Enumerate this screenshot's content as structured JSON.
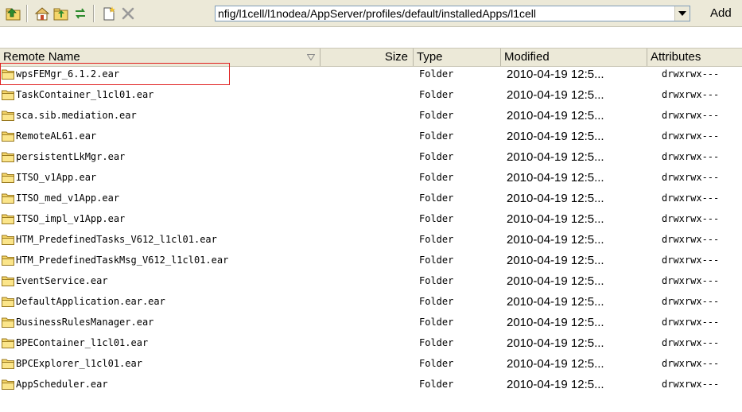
{
  "toolbar": {
    "icons": [
      "parent-directory-icon",
      "home-icon",
      "new-folder-icon",
      "refresh-icon",
      "new-file-icon",
      "delete-icon"
    ],
    "path_value": "nfig/l1cell/l1nodea/AppServer/profiles/default/installedApps/l1cell",
    "add_label": "Add"
  },
  "columns": {
    "name": "Remote Name",
    "size": "Size",
    "type": "Type",
    "modified": "Modified",
    "attributes": "Attributes"
  },
  "files": [
    {
      "name": "wpsFEMgr_6.1.2.ear",
      "type": "Folder",
      "modified": "2010-04-19 12:5...",
      "attributes": "drwxrwx---"
    },
    {
      "name": "TaskContainer_l1cl01.ear",
      "type": "Folder",
      "modified": "2010-04-19 12:5...",
      "attributes": "drwxrwx---"
    },
    {
      "name": "sca.sib.mediation.ear",
      "type": "Folder",
      "modified": "2010-04-19 12:5...",
      "attributes": "drwxrwx---"
    },
    {
      "name": "RemoteAL61.ear",
      "type": "Folder",
      "modified": "2010-04-19 12:5...",
      "attributes": "drwxrwx---"
    },
    {
      "name": "persistentLkMgr.ear",
      "type": "Folder",
      "modified": "2010-04-19 12:5...",
      "attributes": "drwxrwx---"
    },
    {
      "name": "ITSO_v1App.ear",
      "type": "Folder",
      "modified": "2010-04-19 12:5...",
      "attributes": "drwxrwx---"
    },
    {
      "name": "ITSO_med_v1App.ear",
      "type": "Folder",
      "modified": "2010-04-19 12:5...",
      "attributes": "drwxrwx---"
    },
    {
      "name": "ITSO_impl_v1App.ear",
      "type": "Folder",
      "modified": "2010-04-19 12:5...",
      "attributes": "drwxrwx---"
    },
    {
      "name": "HTM_PredefinedTasks_V612_l1cl01.ear",
      "type": "Folder",
      "modified": "2010-04-19 12:5...",
      "attributes": "drwxrwx---"
    },
    {
      "name": "HTM_PredefinedTaskMsg_V612_l1cl01.ear",
      "type": "Folder",
      "modified": "2010-04-19 12:5...",
      "attributes": "drwxrwx---"
    },
    {
      "name": "EventService.ear",
      "type": "Folder",
      "modified": "2010-04-19 12:5...",
      "attributes": "drwxrwx---"
    },
    {
      "name": "DefaultApplication.ear.ear",
      "type": "Folder",
      "modified": "2010-04-19 12:5...",
      "attributes": "drwxrwx---"
    },
    {
      "name": "BusinessRulesManager.ear",
      "type": "Folder",
      "modified": "2010-04-19 12:5...",
      "attributes": "drwxrwx---"
    },
    {
      "name": "BPEContainer_l1cl01.ear",
      "type": "Folder",
      "modified": "2010-04-19 12:5...",
      "attributes": "drwxrwx---"
    },
    {
      "name": "BPCExplorer_l1cl01.ear",
      "type": "Folder",
      "modified": "2010-04-19 12:5...",
      "attributes": "drwxrwx---"
    },
    {
      "name": "AppScheduler.ear",
      "type": "Folder",
      "modified": "2010-04-19 12:5...",
      "attributes": "drwxrwx---"
    }
  ],
  "colors": {
    "toolbar_bg": "#ece9d8",
    "highlight_border": "#e02020",
    "folder_fill": "#f5d66a"
  }
}
